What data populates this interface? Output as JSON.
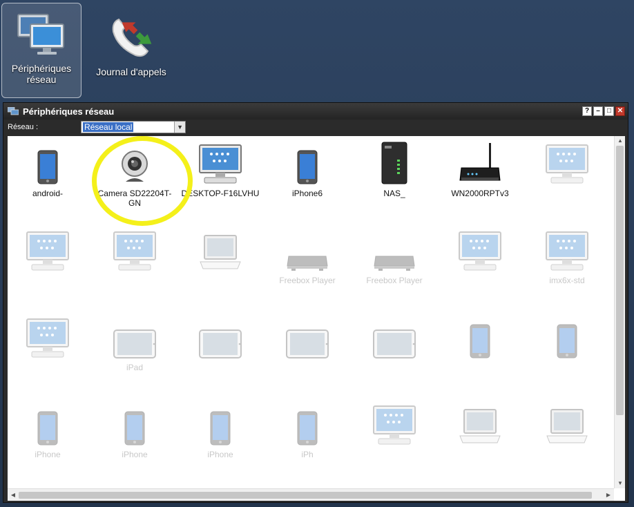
{
  "desktop": {
    "icons": [
      {
        "label": "Périphériques réseau",
        "icon": "network-devices-icon"
      },
      {
        "label": "Journal d'appels",
        "icon": "call-log-icon"
      }
    ]
  },
  "window": {
    "title": "Périphériques réseau",
    "controls": {
      "help": "?",
      "minimize": "–",
      "maximize": "□",
      "close": "✕"
    },
    "network_label": "Réseau :",
    "network_value": "Réseau local",
    "network_arrow": "▼"
  },
  "devices": [
    {
      "name": "android-",
      "type": "phone",
      "faded": false
    },
    {
      "name": "Camera SD22204T-GN",
      "type": "camera",
      "faded": false
    },
    {
      "name": "DESKTOP-F16LVHU",
      "type": "desktop",
      "faded": false
    },
    {
      "name": "iPhone6",
      "type": "phone",
      "faded": false
    },
    {
      "name": "NAS_",
      "type": "nas",
      "faded": false
    },
    {
      "name": "WN2000RPTv3",
      "type": "router",
      "faded": false
    },
    {
      "name": "",
      "type": "desktop",
      "faded": true
    },
    {
      "name": "",
      "type": "desktop",
      "faded": true
    },
    {
      "name": "",
      "type": "desktop",
      "faded": true
    },
    {
      "name": "",
      "type": "laptop",
      "faded": true
    },
    {
      "name": "Freebox Player",
      "type": "box",
      "faded": true
    },
    {
      "name": "Freebox Player",
      "type": "box",
      "faded": true
    },
    {
      "name": "",
      "type": "desktop",
      "faded": true
    },
    {
      "name": "imx6x-std",
      "type": "desktop",
      "faded": true
    },
    {
      "name": "",
      "type": "desktop",
      "faded": true
    },
    {
      "name": "iPad",
      "type": "tablet",
      "faded": true
    },
    {
      "name": "",
      "type": "tablet",
      "faded": true
    },
    {
      "name": "",
      "type": "tablet",
      "faded": true
    },
    {
      "name": "",
      "type": "tablet",
      "faded": true
    },
    {
      "name": "",
      "type": "phone",
      "faded": true
    },
    {
      "name": "",
      "type": "phone",
      "faded": true
    },
    {
      "name": "iPhone",
      "type": "phone",
      "faded": true
    },
    {
      "name": "iPhone",
      "type": "phone",
      "faded": true
    },
    {
      "name": "iPhone",
      "type": "phone",
      "faded": true
    },
    {
      "name": "iPh",
      "type": "phone",
      "faded": true
    },
    {
      "name": "",
      "type": "desktop",
      "faded": true
    },
    {
      "name": "",
      "type": "laptop",
      "faded": true
    },
    {
      "name": "",
      "type": "laptop",
      "faded": true
    }
  ],
  "scrollbar": {
    "up": "▲",
    "down": "▼",
    "left": "◀",
    "right": "▶"
  }
}
